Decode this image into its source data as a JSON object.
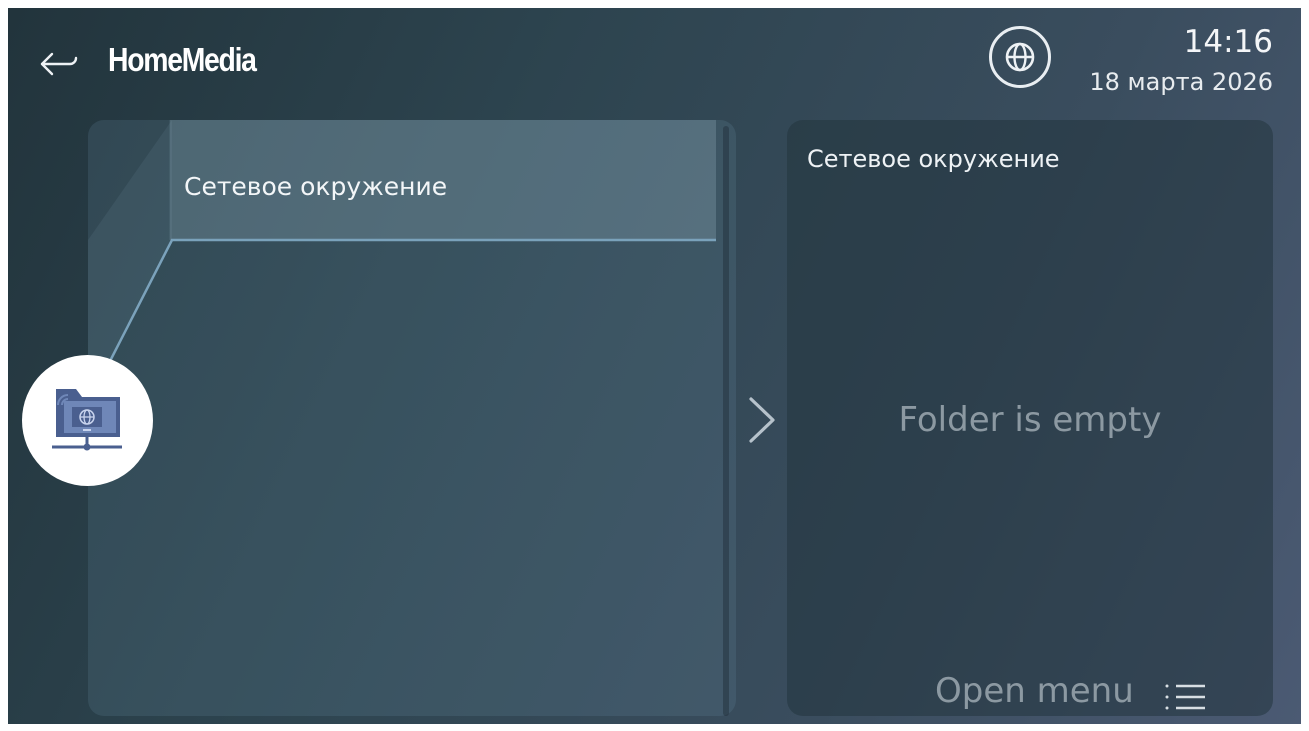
{
  "header": {
    "back_icon": "arrow-left-icon",
    "title": "HomeMedia",
    "globe_icon": "globe-icon",
    "time": "14:16",
    "date": "18 марта 2026"
  },
  "left_panel": {
    "items": [
      {
        "label": "Сетевое окружение",
        "icon": "network-folder-icon",
        "selected": true
      }
    ]
  },
  "navigation": {
    "chevron_icon": "chevron-right-icon"
  },
  "right_panel": {
    "title": "Сетевое окружение",
    "empty_message": "Folder is empty",
    "open_menu_label": "Open menu",
    "menu_icon": "list-menu-icon"
  },
  "colors": {
    "background_start": "#22343c",
    "background_end": "#4b5a73",
    "muted_text": "#8c99a2",
    "icon_accent": "#4a5f8f"
  }
}
